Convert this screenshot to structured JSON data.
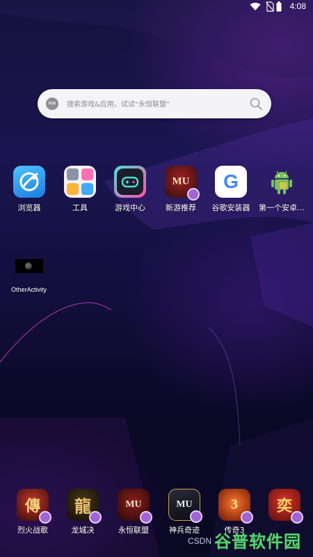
{
  "status_bar": {
    "time": "4:08",
    "icons": [
      "wifi-icon",
      "no-sim-icon",
      "battery-icon"
    ]
  },
  "search": {
    "logo_text": "FOX",
    "placeholder": "搜索游戏&应用，试试“永恒联盟”"
  },
  "apps_row1": [
    {
      "label": "浏览器",
      "icon": "browser-icon"
    },
    {
      "label": "工具",
      "icon": "tools-icon"
    },
    {
      "label": "游戏中心",
      "icon": "game-center-icon"
    },
    {
      "label": "新游推荐",
      "icon": "new-game-icon",
      "icon_text": "MU"
    },
    {
      "label": "谷歌安装器",
      "icon": "google-installer-icon",
      "icon_text": "G"
    },
    {
      "label": "第一个安卓…",
      "icon": "android-icon"
    }
  ],
  "other_activity": {
    "label": "OtherActivity"
  },
  "dock": [
    {
      "label": "烈火战歌",
      "icon": "game-icon",
      "icon_text": "傳"
    },
    {
      "label": "龙城决",
      "icon": "game-icon",
      "icon_text": "龍"
    },
    {
      "label": "永恒联盟",
      "icon": "game-icon",
      "icon_text": "MU"
    },
    {
      "label": "神兵奇迹",
      "icon": "game-icon",
      "icon_text": "MU"
    },
    {
      "label": "传奇3",
      "icon": "game-icon",
      "icon_text": "3"
    },
    {
      "label": "",
      "icon": "game-icon",
      "icon_text": "奕"
    }
  ],
  "watermark": {
    "csdn": "CSDN",
    "site": "谷普软件园"
  }
}
